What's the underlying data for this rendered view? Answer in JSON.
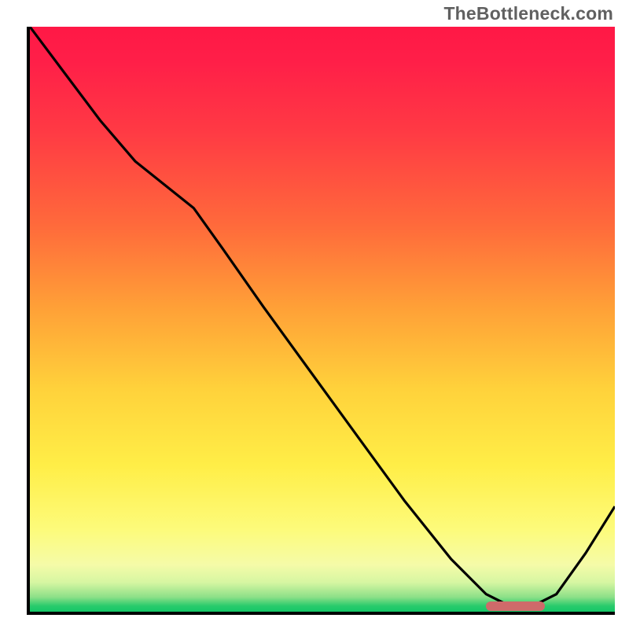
{
  "watermark": "TheBottleneck.com",
  "colors": {
    "gradient_top": "#ff1846",
    "gradient_mid1": "#ff6a3b",
    "gradient_mid2": "#ffd23b",
    "gradient_mid3": "#fdfb7b",
    "gradient_bottom": "#14c768",
    "curve": "#000000",
    "marker": "#cf6a6a",
    "axis": "#000000"
  },
  "chart_data": {
    "type": "line",
    "title": "",
    "xlabel": "",
    "ylabel": "",
    "xlim": [
      0,
      100
    ],
    "ylim": [
      0,
      100
    ],
    "series": [
      {
        "name": "curve",
        "x": [
          0,
          6,
          12,
          18,
          23,
          28,
          33,
          40,
          48,
          56,
          64,
          72,
          78,
          82,
          86,
          90,
          95,
          100
        ],
        "y": [
          100,
          92,
          84,
          77,
          73,
          69,
          62,
          52,
          41,
          30,
          19,
          9,
          3,
          1,
          1,
          3,
          10,
          18
        ]
      }
    ],
    "marker": {
      "x_start": 78,
      "x_end": 88,
      "y": 0
    }
  }
}
